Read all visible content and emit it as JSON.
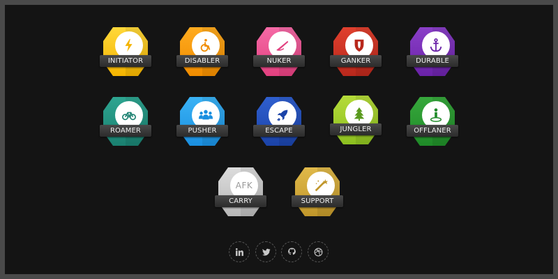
{
  "badges": [
    {
      "label": "INITIATOR",
      "icon": "lightning-icon",
      "color_top": "#ffd83a",
      "color_bottom": "#f4b400"
    },
    {
      "label": "DISABLER",
      "icon": "wheelchair-icon",
      "color_top": "#ffab1f",
      "color_bottom": "#f08c00"
    },
    {
      "label": "NUKER",
      "icon": "pen-icon",
      "color_top": "#f56aa6",
      "color_bottom": "#e2407f"
    },
    {
      "label": "GANKER",
      "icon": "shield-icon",
      "color_top": "#e0402e",
      "color_bottom": "#b8281c"
    },
    {
      "label": "DURABLE",
      "icon": "anchor-icon",
      "color_top": "#8a3fc8",
      "color_bottom": "#6a22a8"
    },
    {
      "label": "ROAMER",
      "icon": "bicycle-icon",
      "color_top": "#2ea591",
      "color_bottom": "#1a8070"
    },
    {
      "label": "PUSHER",
      "icon": "group-icon",
      "color_top": "#3ab2f5",
      "color_bottom": "#1a8fe0"
    },
    {
      "label": "ESCAPE",
      "icon": "rocket-icon",
      "color_top": "#2f5fcf",
      "color_bottom": "#1b43a8"
    },
    {
      "label": "JUNGLER",
      "icon": "tree-icon",
      "color_top": "#b5db3a",
      "color_bottom": "#8cbf20"
    },
    {
      "label": "OFFLANER",
      "icon": "location-person-icon",
      "color_top": "#37a83c",
      "color_bottom": "#1f8a28"
    },
    {
      "label": "CARRY",
      "icon": "afk-text",
      "icon_text": "AFK",
      "color_top": "#dcdcdc",
      "color_bottom": "#b8b8b8"
    },
    {
      "label": "SUPPORT",
      "icon": "magic-wand-icon",
      "color_top": "#e0b94a",
      "color_bottom": "#c0962a"
    }
  ],
  "social": [
    {
      "label": "in",
      "icon": "linkedin-icon"
    },
    {
      "label": "twitter",
      "icon": "twitter-icon"
    },
    {
      "label": "github",
      "icon": "github-icon"
    },
    {
      "label": "dribbble",
      "icon": "dribbble-icon"
    }
  ],
  "colors": {
    "background": "#141414",
    "frame": "#4a4a4a",
    "ribbon": "#333333",
    "social_icon": "#c8c8c8"
  }
}
